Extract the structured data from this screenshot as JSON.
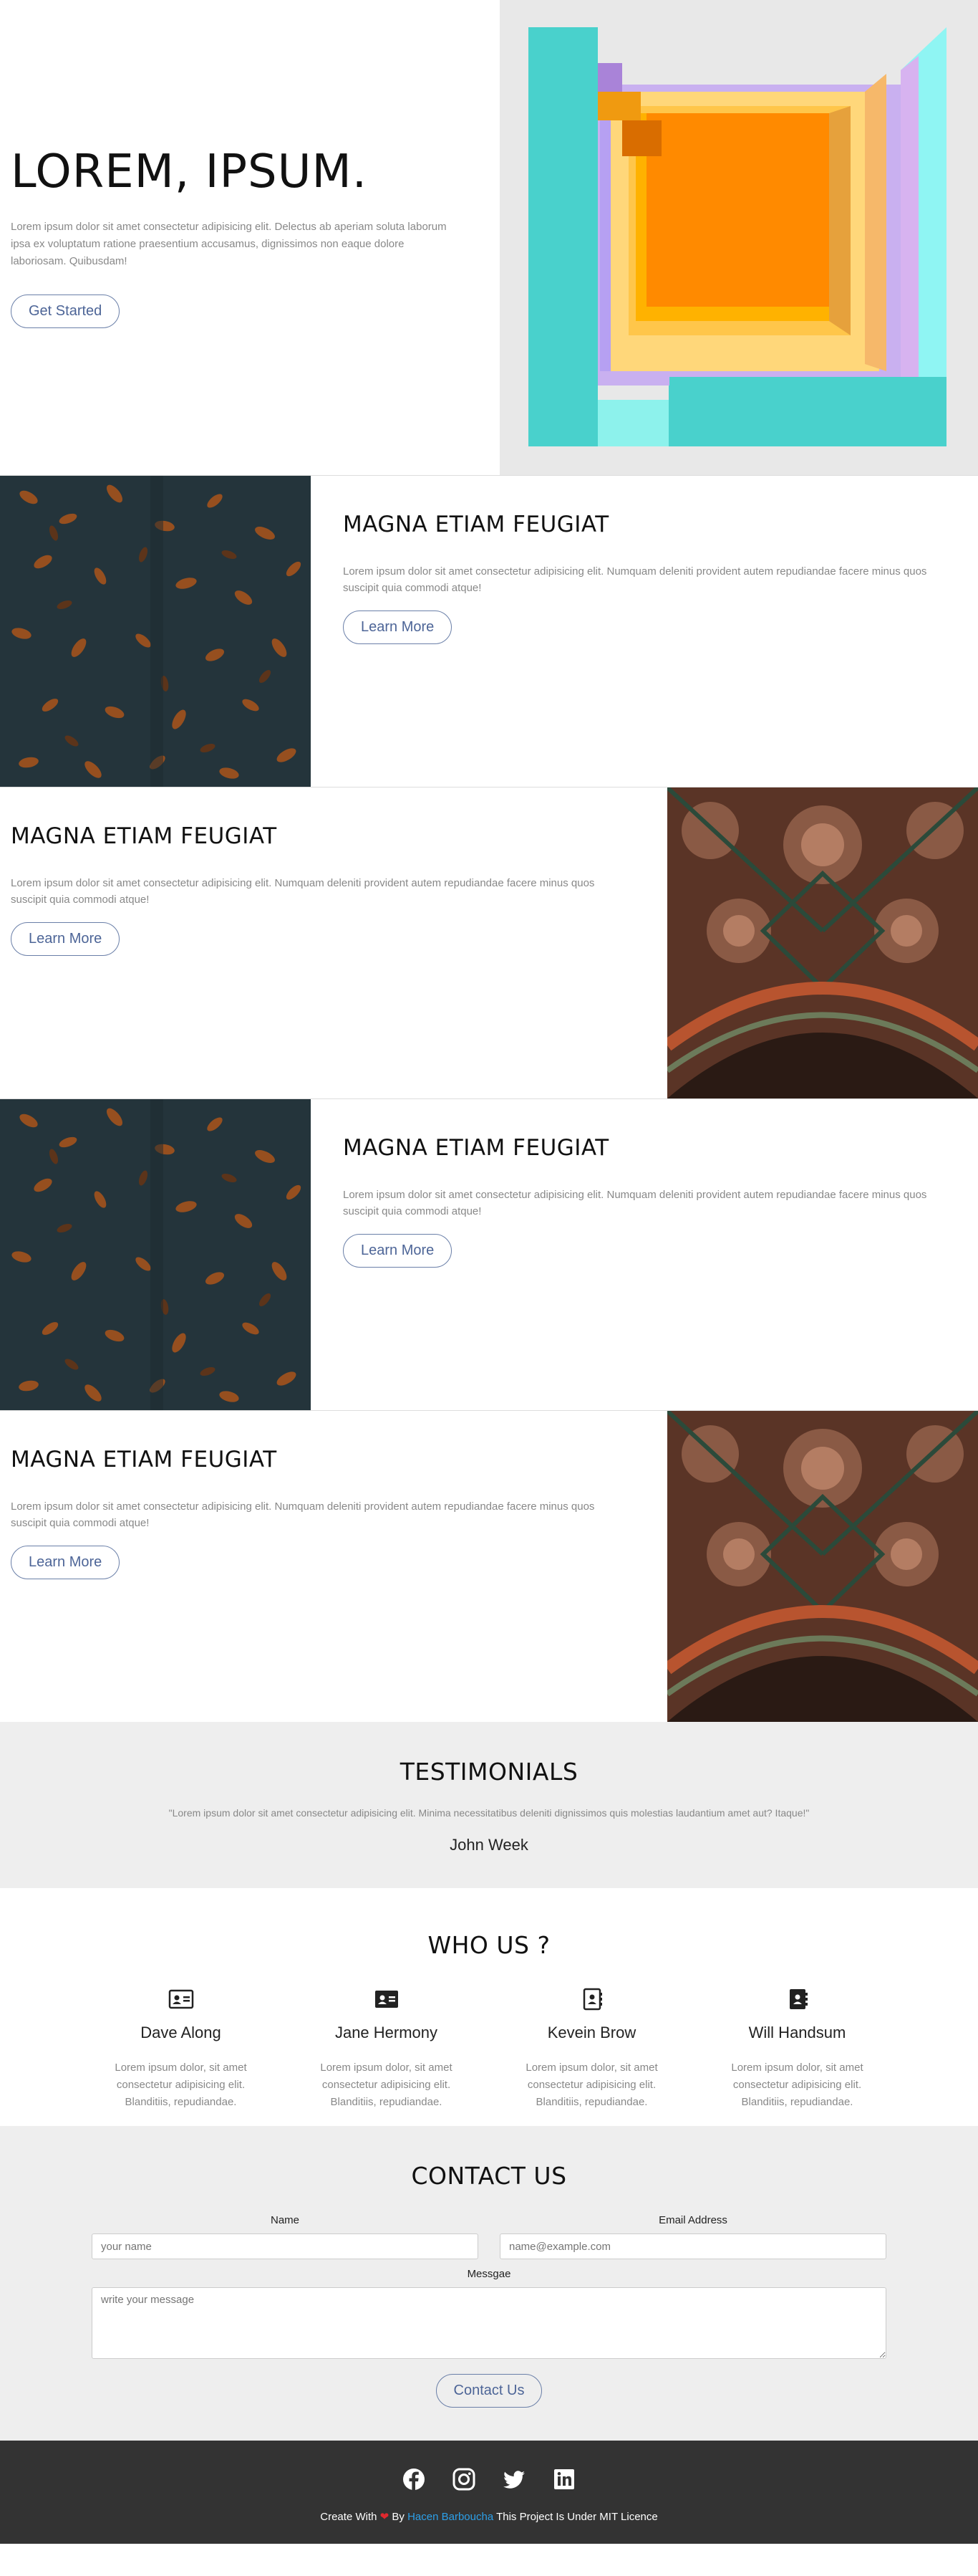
{
  "hero": {
    "title": "LOREM, IPSUM.",
    "text": "Lorem ipsum dolor sit amet consectetur adipisicing elit. Delectus ab aperiam soluta laborum ipsa ex voluptatum ratione praesentium accusamus, dignissimos non eaque dolore laboriosam. Quibusdam!",
    "button": "Get Started"
  },
  "features": [
    {
      "title": "MAGNA ETIAM FEUGIAT",
      "text": "Lorem ipsum dolor sit amet consectetur adipisicing elit. Numquam deleniti provident autem repudiandae facere minus quos suscipit quia commodi atque!",
      "button": "Learn More"
    },
    {
      "title": "MAGNA ETIAM FEUGIAT",
      "text": "Lorem ipsum dolor sit amet consectetur adipisicing elit. Numquam deleniti provident autem repudiandae facere minus quos suscipit quia commodi atque!",
      "button": "Learn More"
    },
    {
      "title": "MAGNA ETIAM FEUGIAT",
      "text": "Lorem ipsum dolor sit amet consectetur adipisicing elit. Numquam deleniti provident autem repudiandae facere minus quos suscipit quia commodi atque!",
      "button": "Learn More"
    },
    {
      "title": "MAGNA ETIAM FEUGIAT",
      "text": "Lorem ipsum dolor sit amet consectetur adipisicing elit. Numquam deleniti provident autem repudiandae facere minus quos suscipit quia commodi atque!",
      "button": "Learn More"
    }
  ],
  "testimonials": {
    "title": "TESTIMONIALS",
    "quote": "\"Lorem ipsum dolor sit amet consectetur adipisicing elit. Minima necessitatibus deleniti dignissimos quis molestias laudantium amet aut? Itaque!\"",
    "author": "John Week"
  },
  "who": {
    "title": "WHO US ?",
    "members": [
      {
        "name": "Dave Along",
        "icon": "id-card-icon",
        "text": "Lorem ipsum dolor, sit amet consectetur adipisicing elit. Blanditiis, repudiandae."
      },
      {
        "name": "Jane Hermony",
        "icon": "id-card-solid-icon",
        "text": "Lorem ipsum dolor, sit amet consectetur adipisicing elit. Blanditiis, repudiandae."
      },
      {
        "name": "Kevein Brow",
        "icon": "address-book-icon",
        "text": "Lorem ipsum dolor, sit amet consectetur adipisicing elit. Blanditiis, repudiandae."
      },
      {
        "name": "Will Handsum",
        "icon": "address-book-solid-icon",
        "text": "Lorem ipsum dolor, sit amet consectetur adipisicing elit. Blanditiis, repudiandae."
      }
    ]
  },
  "contact": {
    "title": "CONTACT US",
    "name_label": "Name",
    "name_placeholder": "your name",
    "email_label": "Email Address",
    "email_placeholder": "name@example.com",
    "message_label": "Messgae",
    "message_placeholder": "write your message",
    "button": "Contact Us"
  },
  "footer": {
    "socials": [
      "facebook-icon",
      "instagram-icon",
      "twitter-icon",
      "linkedin-icon"
    ],
    "credit_prefix": "Create With",
    "credit_by": "By",
    "credit_author": "Hacen Barboucha",
    "credit_suffix": "This Project Is Under MIT Licence"
  },
  "colors": {
    "accent": "#4d6597",
    "testimonial_bg": "#eeeeee",
    "footer_bg": "#333333",
    "author_link": "#2c9fe8",
    "heart": "#e0282e"
  }
}
